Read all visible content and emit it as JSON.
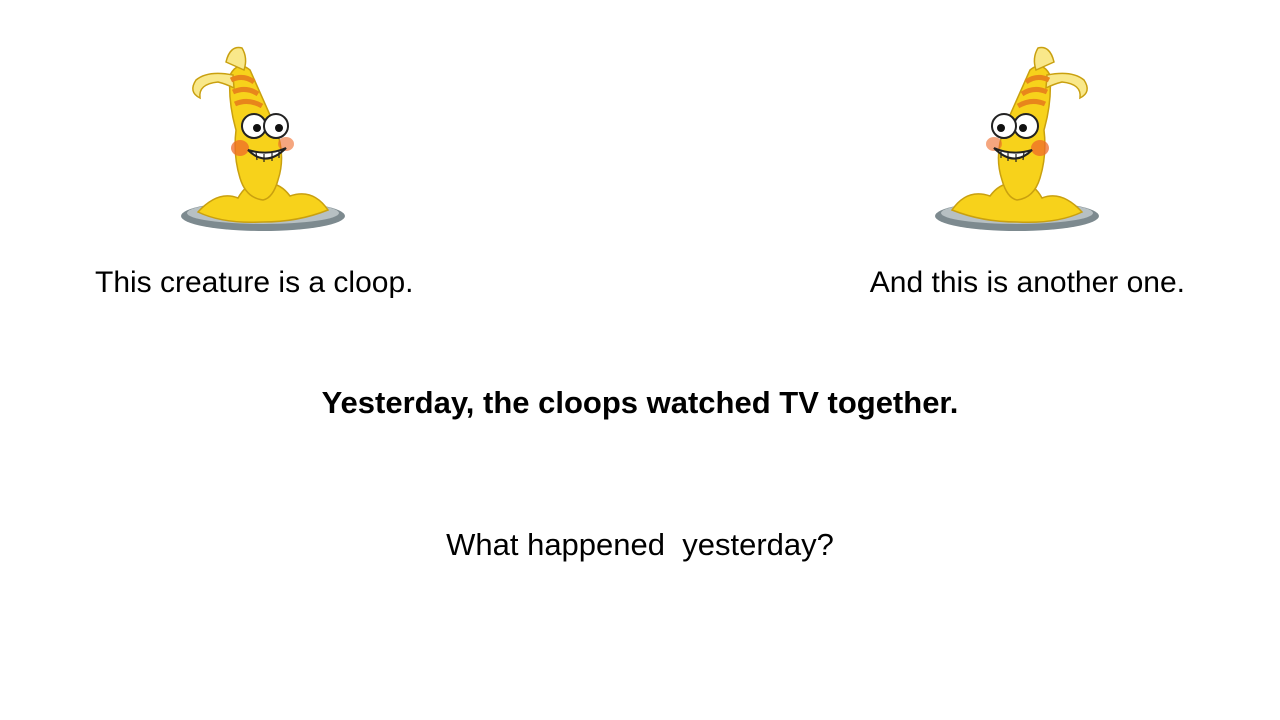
{
  "slide": {
    "background": "#ffffff",
    "creature_left": {
      "icon": "cloop-creature-icon",
      "facing": "right"
    },
    "creature_right": {
      "icon": "cloop-creature-icon",
      "facing": "left"
    },
    "caption_left": "This creature is a cloop.",
    "caption_right": "And this is another one.",
    "statement": "Yesterday, the cloops watched TV together.",
    "question": "What happened  yesterday?"
  },
  "colors": {
    "creature_body": "#f7d21b",
    "creature_stripe": "#e8861b",
    "creature_cheek": "#ef6a2a",
    "puddle": "#7d8a8f"
  }
}
